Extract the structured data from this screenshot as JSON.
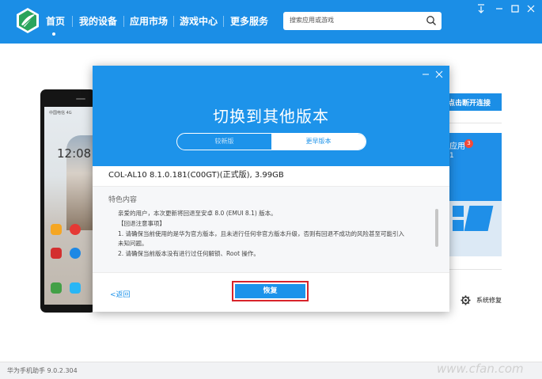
{
  "app": {
    "version_label": "华为手机助手 9.0.2.304"
  },
  "nav": {
    "items": [
      {
        "label": "首页"
      },
      {
        "label": "我的设备"
      },
      {
        "label": "应用市场"
      },
      {
        "label": "游戏中心"
      },
      {
        "label": "更多服务"
      }
    ],
    "active_index": 0
  },
  "search": {
    "placeholder": "搜索应用或游戏"
  },
  "background": {
    "phone": {
      "status_text": "中国电信 4G",
      "clock": "12:08"
    },
    "connect_button": "点击断开连接",
    "apps_card": {
      "label": "应用",
      "badge": "3",
      "number": "1"
    },
    "repair_label": "系统修复"
  },
  "dialog": {
    "title": "切换到其他版本",
    "tabs": [
      {
        "label": "较新版"
      },
      {
        "label": "更早版本"
      }
    ],
    "selected_tab": 1,
    "package_info": "COL-AL10 8.1.0.181(C00GT)(正式版), 3.99GB",
    "features_title": "特色内容",
    "notes": [
      "亲爱的用户，本次更新将回退至安卓 8.0 (EMUI 8.1) 版本。",
      "【回退注意事项】",
      "1. 请确保当前使用的是华为官方版本，且未进行任何非官方版本升级，否则有回退不成功的风险甚至可能引入",
      "未知问题。",
      "2. 请确保当前版本没有进行过任何解锁、Root 操作。"
    ],
    "back_label": "<返回",
    "restore_label": "恢复"
  },
  "colors": {
    "brand_blue": "#1b8ee6",
    "dialog_header": "#1d93ea",
    "highlight_red": "#d8232a"
  },
  "watermark": "www.cfan.com.cn"
}
